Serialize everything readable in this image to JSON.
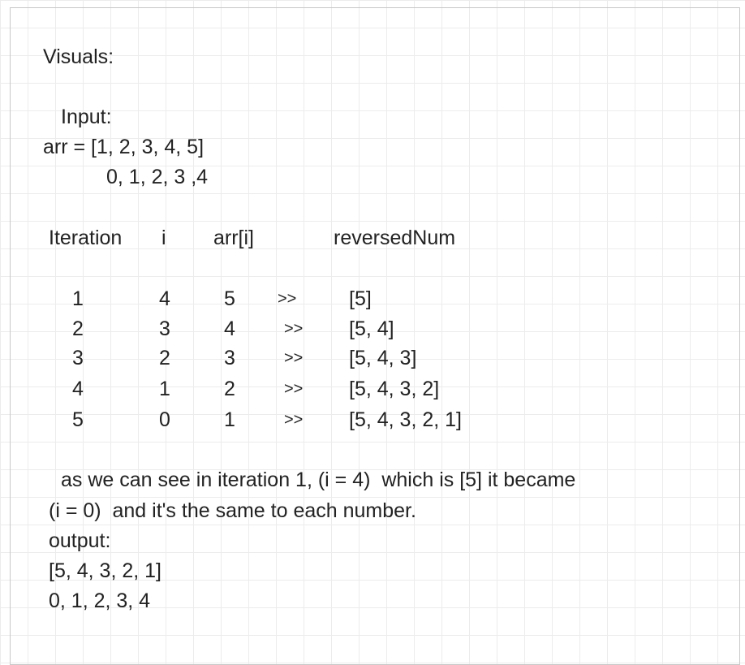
{
  "heading": "Visuals:",
  "input": {
    "label": "Input:",
    "array_line": "arr = [1, 2, 3, 4, 5]",
    "index_line": "0, 1, 2, 3 ,4"
  },
  "table": {
    "headers": [
      "Iteration",
      "i",
      "arr[i]",
      "reversedNum"
    ],
    "arrow": ">>",
    "rows": [
      {
        "iteration": "1",
        "i": "4",
        "value": "5",
        "reversed": "[5]"
      },
      {
        "iteration": "2",
        "i": "3",
        "value": "4",
        "reversed": "[5, 4]"
      },
      {
        "iteration": "3",
        "i": "2",
        "value": "3",
        "reversed": "[5, 4, 3]"
      },
      {
        "iteration": "4",
        "i": "1",
        "value": "2",
        "reversed": "[5, 4, 3, 2]"
      },
      {
        "iteration": "5",
        "i": "0",
        "value": "1",
        "reversed": "[5, 4, 3, 2, 1]"
      }
    ]
  },
  "explanation": {
    "line1": "as we can see in iteration 1, (i = 4)  which is [5] it became",
    "line2": "(i = 0)  and it's the same to each number."
  },
  "output": {
    "label": "output:",
    "array_line": "[5, 4, 3, 2, 1]",
    "index_line": "0, 1, 2, 3, 4"
  }
}
